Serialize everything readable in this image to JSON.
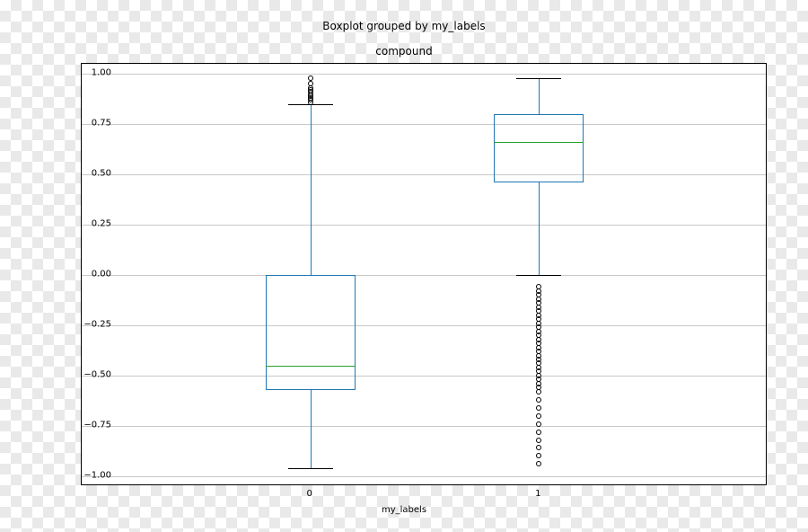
{
  "chart_data": {
    "type": "boxplot",
    "title": "Boxplot grouped by my_labels",
    "subtitle": "compound",
    "xlabel": "my_labels",
    "ylabel": "",
    "ylim": [
      -1.05,
      1.05
    ],
    "yticks": [
      -1.0,
      -0.75,
      -0.5,
      -0.25,
      0.0,
      0.25,
      0.5,
      0.75,
      1.0
    ],
    "categories": [
      "0",
      "1"
    ],
    "boxes": [
      {
        "category": "0",
        "whisker_low": -0.96,
        "q1": -0.57,
        "median": -0.45,
        "q3": 0.0,
        "whisker_high": 0.85,
        "outliers": [
          0.86,
          0.87,
          0.88,
          0.89,
          0.9,
          0.91,
          0.92,
          0.93,
          0.95,
          0.98
        ]
      },
      {
        "category": "1",
        "whisker_low": 0.0,
        "q1": 0.46,
        "median": 0.66,
        "q3": 0.8,
        "whisker_high": 0.98,
        "outliers": [
          -0.06,
          -0.08,
          -0.1,
          -0.12,
          -0.14,
          -0.16,
          -0.18,
          -0.2,
          -0.22,
          -0.24,
          -0.26,
          -0.28,
          -0.3,
          -0.32,
          -0.34,
          -0.36,
          -0.38,
          -0.4,
          -0.42,
          -0.44,
          -0.46,
          -0.48,
          -0.5,
          -0.52,
          -0.54,
          -0.56,
          -0.58,
          -0.62,
          -0.66,
          -0.7,
          -0.74,
          -0.78,
          -0.82,
          -0.86,
          -0.9,
          -0.94
        ]
      }
    ]
  }
}
